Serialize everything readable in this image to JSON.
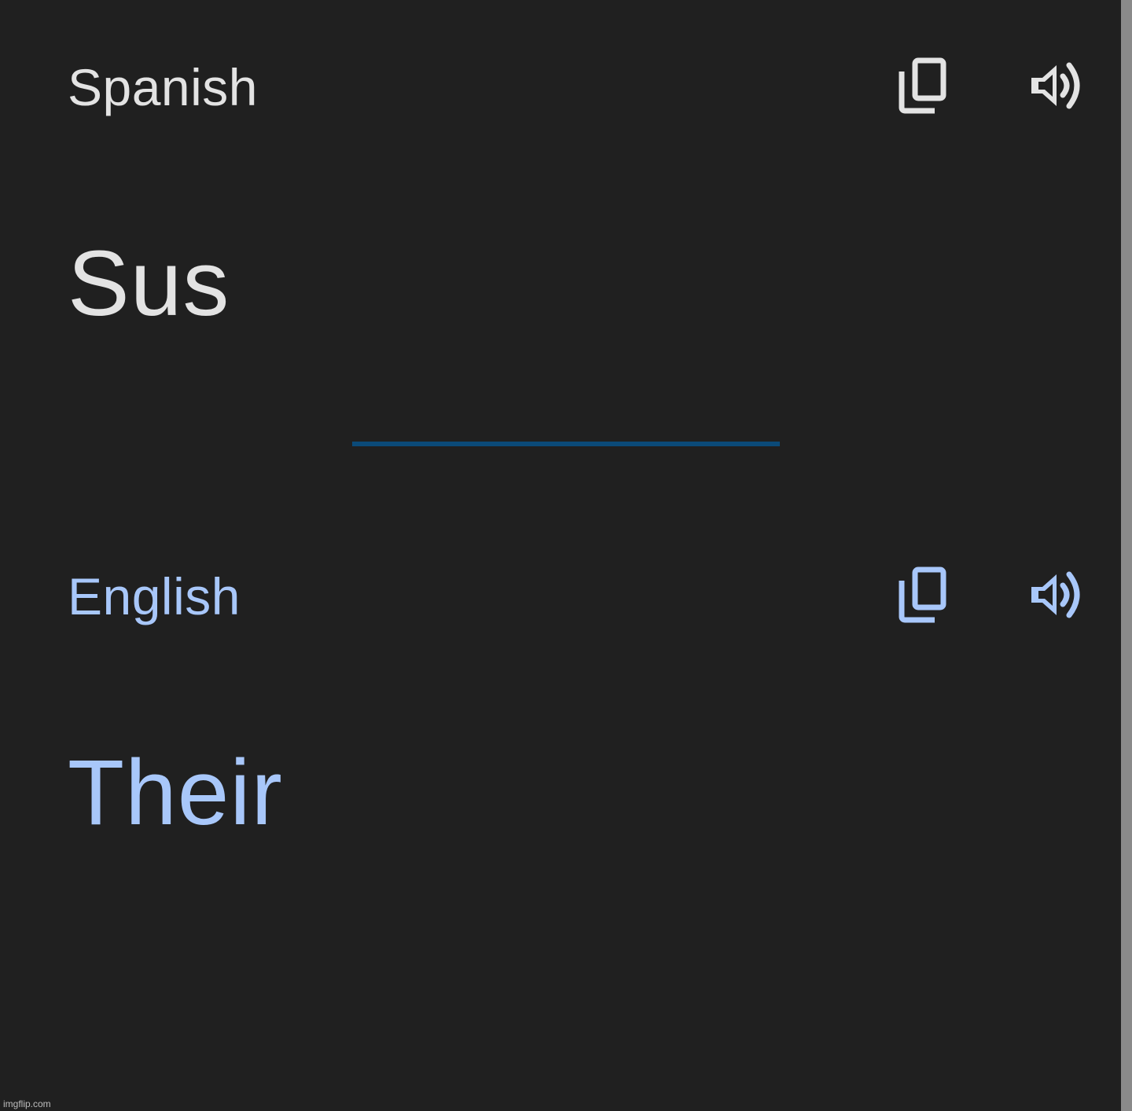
{
  "source": {
    "language": "Spanish",
    "text": "Sus",
    "copy_icon": "copy-icon",
    "speak_icon": "speaker-icon",
    "color": "#e3e3e3"
  },
  "target": {
    "language": "English",
    "text": "Their",
    "copy_icon": "copy-icon",
    "speak_icon": "speaker-icon",
    "color": "#a8c7fa"
  },
  "divider_color": "#0b4a78",
  "background_color": "#202020",
  "watermark": "imgflip.com"
}
